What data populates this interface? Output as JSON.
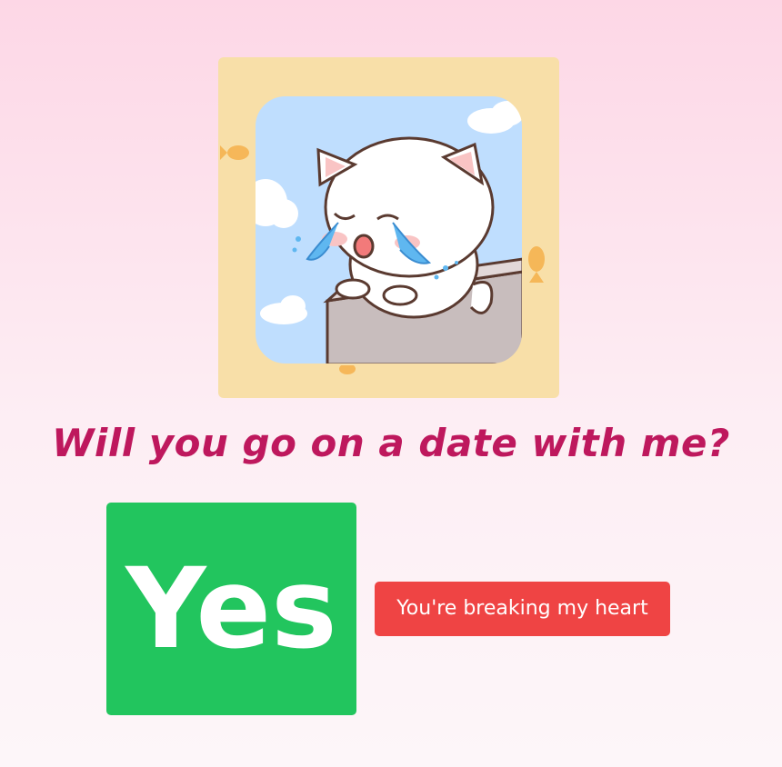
{
  "image": {
    "icon": "crying-cat-sticker",
    "frame_color": "#f8dfa8",
    "sky_color": "#bfdefe"
  },
  "question": {
    "text": "Will you go on a date with me?",
    "color": "#be185d"
  },
  "buttons": {
    "yes_label": "Yes",
    "yes_color": "#22c55e",
    "no_label": "You're breaking my heart",
    "no_color": "#ef4444"
  }
}
